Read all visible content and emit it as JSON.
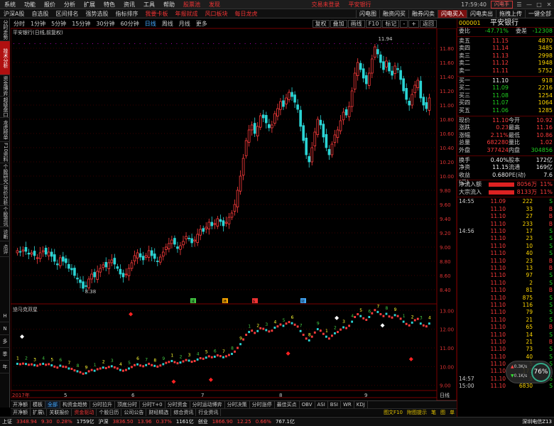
{
  "menubar": {
    "items": [
      "系统",
      "功能",
      "报价",
      "分析",
      "扩展",
      "特色",
      "资讯",
      "工具",
      "帮助"
    ],
    "highlights": [
      "股票池",
      "发现"
    ],
    "center": [
      "交易未登录",
      "平安银行"
    ],
    "clock": "17:59:40",
    "right": [
      "闪电手",
      "☰",
      "—",
      "□",
      "✕"
    ]
  },
  "navbar": {
    "left": [
      "沪深A股",
      "自选股",
      "区间排名",
      "强势选股",
      "指标排序"
    ],
    "red": [
      "我要卡板",
      "年报就成",
      "风口板块",
      "每日龙虎"
    ],
    "right": [
      "闪电图",
      "融资闪买",
      "融券闪卖",
      "闪电买入",
      "闪电卖出",
      "拖拽上传",
      "一键全部"
    ]
  },
  "leftstrip": {
    "tabs": [
      "分时走势",
      "技术分析",
      "资金博弈",
      "超级盘口",
      "龙虎榜单",
      "F10资料",
      "个股研究",
      "竞价分析",
      "个股资讯",
      "诊断",
      "点评"
    ],
    "active": 1,
    "bottom": [
      "H",
      "N",
      "多",
      "季",
      "年"
    ]
  },
  "periodbar": {
    "items": [
      "分时",
      "1分钟",
      "5分钟",
      "15分钟",
      "30分钟",
      "60分钟",
      "日线",
      "周线",
      "月线",
      "更多"
    ],
    "active": 6,
    "tools": [
      "复权",
      "叠加",
      "画线",
      "F10",
      "标记",
      "-",
      "+",
      "返回"
    ]
  },
  "chart": {
    "title": "平安银行(日线,前复权)",
    "subtitle": "迪马克双星",
    "dates": [
      "2017年",
      "5",
      "6",
      "7",
      "8",
      "9",
      "日线"
    ],
    "annotations": [
      "11.94",
      "8.38"
    ]
  },
  "chart_data": {
    "type": "candlestick",
    "title": "平安银行(日线,前复权)",
    "ylim": [
      8.3,
      11.98
    ],
    "yticks": [
      8.4,
      8.6,
      8.8,
      9.0,
      9.2,
      9.4,
      9.6,
      9.8,
      10.0,
      10.2,
      10.4,
      10.6,
      10.8,
      11.0,
      11.2,
      11.4,
      11.6,
      11.8
    ],
    "sub_ylim": [
      8.8,
      13.2
    ],
    "sub_yticks": [
      9.0,
      10.0,
      11.0,
      12.0,
      13.0
    ],
    "high": 11.94,
    "low": 8.38,
    "closes": [
      8.95,
      8.93,
      8.96,
      8.94,
      8.9,
      8.92,
      8.88,
      8.85,
      8.92,
      8.95,
      8.9,
      8.93,
      8.87,
      8.8,
      8.75,
      8.85,
      8.8,
      8.78,
      8.7,
      8.68,
      8.6,
      8.55,
      8.5,
      8.42,
      8.45,
      8.55,
      8.62,
      8.58,
      8.66,
      8.7,
      8.75,
      8.72,
      8.78,
      8.82,
      8.76,
      8.7,
      8.62,
      8.58,
      8.62,
      8.7,
      8.78,
      8.88,
      8.92,
      8.86,
      8.82,
      8.88,
      8.95,
      8.88,
      8.84,
      8.8,
      8.86,
      8.93,
      9.0,
      9.05,
      9.1,
      9.04,
      8.98,
      9.02,
      9.08,
      9.15,
      9.12,
      9.06,
      9.1,
      9.18,
      9.25,
      9.22,
      9.28,
      9.35,
      9.3,
      9.33,
      9.4,
      9.36,
      9.3,
      9.35,
      9.42,
      9.48,
      9.6,
      9.8,
      10.0,
      10.25,
      10.5,
      10.65,
      10.72,
      10.6,
      10.7,
      10.85,
      10.82,
      10.75,
      10.68,
      10.72,
      10.88,
      10.95,
      11.05,
      10.98,
      11.1,
      11.18,
      11.12,
      11.04,
      10.94,
      10.7,
      10.5,
      10.3,
      10.2,
      10.4,
      10.62,
      10.8,
      10.72,
      10.55,
      10.4,
      10.3,
      10.45,
      10.58,
      10.65,
      10.78,
      10.9,
      10.86,
      10.98,
      11.2,
      11.45,
      11.6,
      11.5,
      11.38,
      11.3,
      11.45,
      11.65,
      11.82,
      11.72,
      11.6,
      11.5,
      11.62,
      11.48,
      11.42,
      11.55,
      11.5,
      11.36,
      11.2,
      11.08,
      11.0,
      11.15,
      11.28,
      11.35,
      11.1,
      11.0,
      10.95,
      11.1
    ],
    "sub_markers": [
      {
        "x": 2,
        "y": 11.6,
        "kind": "diamond-white"
      },
      {
        "x": 40,
        "y": 12.8,
        "kind": "diamond-red"
      },
      {
        "x": 55,
        "y": 9.2,
        "kind": "diamond-red"
      },
      {
        "x": 68,
        "y": 9.3,
        "kind": "diamond-red"
      },
      {
        "x": 95,
        "y": 10.7,
        "kind": "diamond-red"
      },
      {
        "x": 112,
        "y": 12.6,
        "kind": "diamond-white"
      },
      {
        "x": 128,
        "y": 12.2,
        "kind": "diamond-white"
      },
      {
        "x": 138,
        "y": 10.4,
        "kind": "diamond-red"
      }
    ]
  },
  "panel": {
    "stock_name": "平安银行",
    "stock_code": "000001",
    "webi_label": "委比",
    "webi_val": "-47.71%",
    "wecha_label": "委差",
    "wecha_val": "-12308",
    "asks": [
      [
        "卖五",
        "11.15",
        "4870"
      ],
      [
        "卖四",
        "11.14",
        "3485"
      ],
      [
        "卖三",
        "11.13",
        "2998"
      ],
      [
        "卖二",
        "11.12",
        "1948"
      ],
      [
        "卖一",
        "11.11",
        "5752"
      ]
    ],
    "bids": [
      [
        "买一",
        "11.10",
        "918"
      ],
      [
        "买二",
        "11.09",
        "2216"
      ],
      [
        "买三",
        "11.08",
        "1254"
      ],
      [
        "买四",
        "11.07",
        "1064"
      ],
      [
        "买五",
        "11.06",
        "1285"
      ]
    ],
    "stats": [
      [
        "现价",
        "11.10",
        "今开",
        "10.92"
      ],
      [
        "涨跌",
        "0.23",
        "最高",
        "11.16"
      ],
      [
        "涨幅",
        "2.11%",
        "最低",
        "10.86"
      ],
      [
        "总量",
        "682280",
        "量比",
        "1.02"
      ],
      [
        "外盘",
        "377424",
        "内盘",
        "304856"
      ]
    ],
    "stats2": [
      [
        "换手",
        "0.40%",
        "股本",
        "172亿"
      ],
      [
        "净资",
        "11.15",
        "流通",
        "169亿"
      ],
      [
        "收益(二)",
        "0.680",
        "PE(动)",
        "7.6"
      ]
    ],
    "flows": [
      [
        "净流入额",
        "8056万",
        "11%"
      ],
      [
        "大宗流入",
        "8133万",
        "11%"
      ]
    ],
    "ticks": [
      [
        "14:55",
        "11.09",
        "222",
        "S"
      ],
      [
        "",
        "11.10",
        "33",
        "B"
      ],
      [
        "",
        "11.10",
        "27",
        "B"
      ],
      [
        "",
        "11.10",
        "233",
        "B"
      ],
      [
        "14:56",
        "11.10",
        "17",
        "S"
      ],
      [
        "",
        "11.10",
        "23",
        "S"
      ],
      [
        "",
        "11.10",
        "10",
        "S"
      ],
      [
        "",
        "11.10",
        "40",
        "S"
      ],
      [
        "",
        "11.10",
        "23",
        "B"
      ],
      [
        "",
        "11.10",
        "13",
        "B"
      ],
      [
        "",
        "11.10",
        "97",
        "S"
      ],
      [
        "",
        "11.10",
        "2",
        "S"
      ],
      [
        "",
        "11.10",
        "81",
        "B"
      ],
      [
        "",
        "11.10",
        "875",
        "S"
      ],
      [
        "",
        "11.10",
        "116",
        "S"
      ],
      [
        "",
        "11.10",
        "79",
        "S"
      ],
      [
        "",
        "11.10",
        "21",
        "S"
      ],
      [
        "",
        "11.10",
        "65",
        "B"
      ],
      [
        "",
        "11.10",
        "14",
        "S"
      ],
      [
        "",
        "11.10",
        "21",
        "B"
      ],
      [
        "",
        "11.10",
        "73",
        "S"
      ],
      [
        "",
        "11.10",
        "40",
        "S"
      ],
      [
        "",
        "11.10",
        "5",
        "S"
      ],
      [
        "",
        "11.10",
        "173",
        "B"
      ],
      [
        "14:57",
        "11.10",
        "5",
        "S"
      ],
      [
        "15:00",
        "11.10",
        "6830",
        "S"
      ]
    ],
    "gauge_up": "0.3K/s",
    "gauge_dn": "0.1K/s",
    "gauge_pct": "76%"
  },
  "tabs1": [
    "开净额",
    "模板",
    "全部",
    "构资金趋势",
    "分时拉升",
    "顶底分时",
    "分时T+0",
    "分时资金",
    "分时运动博弈",
    "分时决策",
    "分时涨停",
    "最佳买点",
    "OBV",
    "ASI",
    "BSI",
    "WR",
    "KDJ"
  ],
  "tabs1_active": 2,
  "tabs2": [
    "开净额",
    "扩展\\",
    "关联报价",
    "资金驱动",
    "个股日历",
    "公司公告",
    "财经精选",
    "综合资讯",
    "行业资讯"
  ],
  "tabs2_right": [
    "图文F10",
    "附图提示",
    "笔",
    "图",
    "单"
  ],
  "statusbar": [
    [
      "上证",
      "3348.94",
      "9.30",
      "0.28%",
      "1759亿"
    ],
    [
      "沪深",
      "3836.50",
      "13.96",
      "0.37%",
      "1161亿"
    ],
    [
      "创业",
      "1866.90",
      "12.25",
      "0.66%",
      "767.1亿"
    ]
  ],
  "statusbar_right": "深圳电信Z13"
}
